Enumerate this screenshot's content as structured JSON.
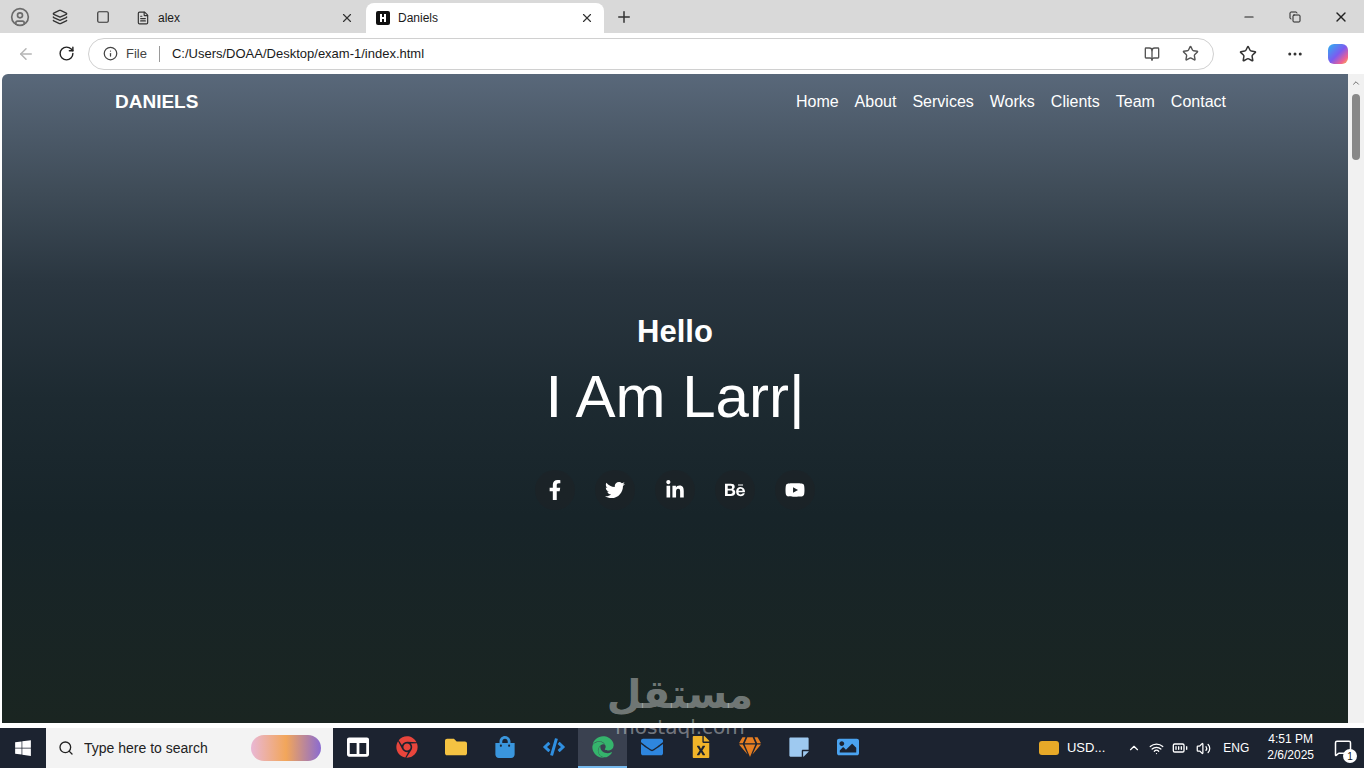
{
  "browser": {
    "tabs": [
      {
        "label": "alex",
        "selected": false,
        "kind": "page"
      },
      {
        "label": "Daniels",
        "selected": true,
        "kind": "site"
      }
    ],
    "address": {
      "scheme": "File",
      "url": "C:/Users/DOAA/Desktop/exam-1/index.html"
    }
  },
  "page": {
    "brand": "DANIELS",
    "nav": [
      "Home",
      "About",
      "Services",
      "Works",
      "Clients",
      "Team",
      "Contact"
    ],
    "greeting": "Hello",
    "headline": "I Am Larr",
    "cursor": "|",
    "socials": [
      {
        "kind": "facebook"
      },
      {
        "kind": "twitter"
      },
      {
        "kind": "linkedin"
      },
      {
        "kind": "behance"
      },
      {
        "kind": "youtube"
      }
    ],
    "scrollbar": {
      "level": 0
    }
  },
  "watermark": {
    "text": "مستقل",
    "domain": "mostaql.com"
  },
  "taskbar": {
    "search_placeholder": "Type here to search",
    "apps": [
      {
        "kind": "task-view",
        "selected": false
      },
      {
        "kind": "chrome",
        "selected": false
      },
      {
        "kind": "explorer",
        "selected": false
      },
      {
        "kind": "store",
        "selected": false
      },
      {
        "kind": "vscode",
        "selected": false
      },
      {
        "kind": "edge",
        "selected": true
      },
      {
        "kind": "mail",
        "selected": false
      },
      {
        "kind": "excel",
        "selected": false
      },
      {
        "kind": "gem",
        "selected": false
      },
      {
        "kind": "notes",
        "selected": false
      },
      {
        "kind": "photos",
        "selected": false
      }
    ],
    "currency": "USD...",
    "language": "ENG",
    "time": "4:51 PM",
    "date": "2/6/2025",
    "notifications": "1"
  }
}
